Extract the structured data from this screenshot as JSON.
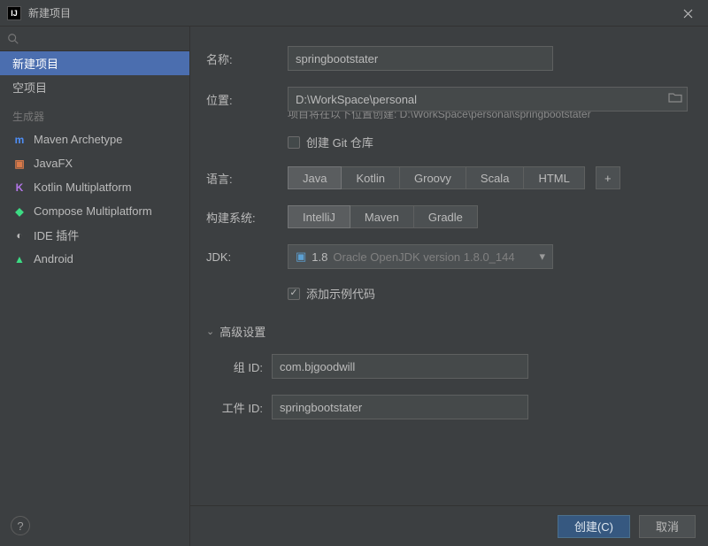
{
  "window": {
    "title": "新建项目",
    "app_icon_text": "IJ"
  },
  "sidebar": {
    "items_top": [
      {
        "label": "新建项目",
        "selected": true
      },
      {
        "label": "空项目",
        "selected": false
      }
    ],
    "group_header": "生成器",
    "generators": [
      {
        "label": "Maven Archetype",
        "icon": "m",
        "color": "#4e8ef7"
      },
      {
        "label": "JavaFX",
        "icon": "▣",
        "color": "#d97a4a"
      },
      {
        "label": "Kotlin Multiplatform",
        "icon": "K",
        "color": "#b376e8"
      },
      {
        "label": "Compose Multiplatform",
        "icon": "◆",
        "color": "#3ddc84"
      },
      {
        "label": "IDE 插件",
        "icon": "◐",
        "color": "#bbbbbb"
      },
      {
        "label": "Android",
        "icon": "▲",
        "color": "#3ddc84"
      }
    ],
    "help_label": "?"
  },
  "form": {
    "name_label": "名称:",
    "name_value": "springbootstater",
    "location_label": "位置:",
    "location_value": "D:\\WorkSpace\\personal",
    "location_hint_prefix": "项目将在以下位置创建: ",
    "location_hint_path": "D:\\WorkSpace\\personal\\springbootstater",
    "git_label": "创建 Git 仓库",
    "git_checked": false,
    "language_label": "语言:",
    "languages": [
      "Java",
      "Kotlin",
      "Groovy",
      "Scala",
      "HTML"
    ],
    "language_selected": "Java",
    "plus_label": "+",
    "build_label": "构建系统:",
    "build_systems": [
      "IntelliJ",
      "Maven",
      "Gradle"
    ],
    "build_selected": "IntelliJ",
    "jdk_label": "JDK:",
    "jdk_version": "1.8",
    "jdk_desc": "Oracle OpenJDK version 1.8.0_144",
    "sample_label": "添加示例代码",
    "sample_checked": true,
    "advanced_header": "高级设置",
    "group_id_label": "组 ID:",
    "group_id_value": "com.bjgoodwill",
    "artifact_id_label": "工件 ID:",
    "artifact_id_value": "springbootstater"
  },
  "footer": {
    "create": "创建(C)",
    "cancel": "取消"
  }
}
